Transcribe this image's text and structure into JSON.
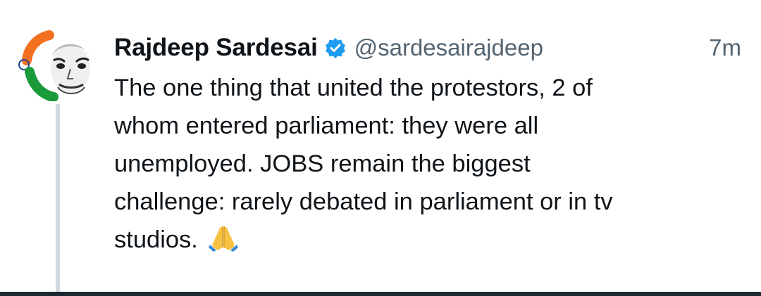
{
  "tweet": {
    "author": {
      "display_name": "Rajdeep Sardesai",
      "handle": "@sardesairajdeep",
      "verified_icon": "verified-badge-icon",
      "avatar": "avatar-photo"
    },
    "timestamp": "7m",
    "text": "The one thing that united the protestors, 2 of\nwhom entered parliament: they were all\nunemployed. JOBS remain the biggest\nchallenge: rarely debated in parliament or in tv\nstudios.",
    "emoji_icon": "folded-hands-icon"
  },
  "colors": {
    "text": "#0f1419",
    "muted": "#536471",
    "verified": "#1d9bf0",
    "thread_line": "#cfd9de"
  }
}
